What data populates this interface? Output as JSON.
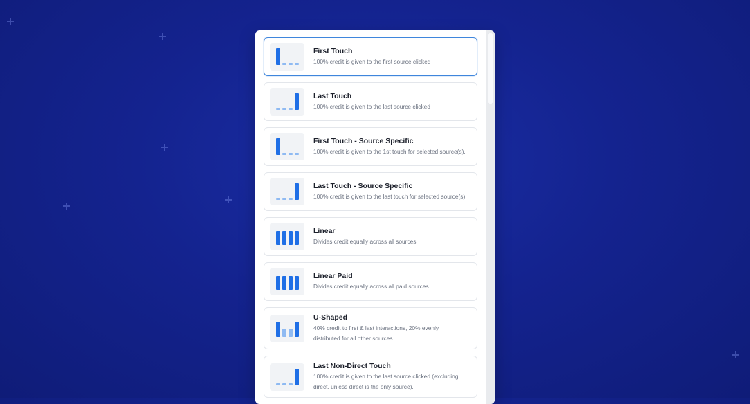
{
  "attribution_models": [
    {
      "title": "First Touch",
      "desc": "100% credit is given to the first source clicked",
      "icon": "first-touch-icon",
      "selected": true
    },
    {
      "title": "Last Touch",
      "desc": "100% credit is given to the last source clicked",
      "icon": "last-touch-icon",
      "selected": false
    },
    {
      "title": "First Touch - Source Specific",
      "desc": "100% credit is given to the 1st touch for selected source(s).",
      "icon": "first-touch-icon",
      "selected": false
    },
    {
      "title": "Last Touch - Source Specific",
      "desc": "100% credit is given to the last touch for selected source(s).",
      "icon": "last-touch-icon",
      "selected": false
    },
    {
      "title": "Linear",
      "desc": "Divides credit equally across all sources",
      "icon": "linear-icon",
      "selected": false
    },
    {
      "title": "Linear Paid",
      "desc": "Divides credit equally across all paid sources",
      "icon": "linear-icon",
      "selected": false
    },
    {
      "title": "U-Shaped",
      "desc_line1": "40% credit to first & last interactions, 20% evenly",
      "desc_line2": "distributed for all other sources",
      "icon": "u-shaped-icon",
      "selected": false
    },
    {
      "title": "Last Non-Direct Touch",
      "desc_line1": "100% credit is given to the last source clicked (excluding",
      "desc_line2": "direct, unless direct is the only source).",
      "icon": "last-touch-icon",
      "selected": false
    }
  ],
  "colors": {
    "accent": "#1f6fe6",
    "accent_light": "#8fbaf2",
    "selected_border": "#3f86dc"
  }
}
